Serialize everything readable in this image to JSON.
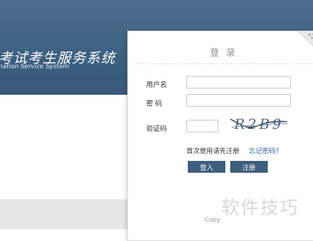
{
  "header": {
    "title": "考试考生服务系统",
    "subtitle": "nation Service System"
  },
  "login": {
    "title": "登 录",
    "username_label": "用户名",
    "username_value": "",
    "password_label": "密 码",
    "password_value": "",
    "captcha_label": "验证码",
    "captcha_value": "",
    "captcha_text": "R2B9",
    "first_use_text": "首次使用请先注册",
    "forgot_text": "忘记密码?",
    "login_button": "登入",
    "register_button": "注册",
    "copyright": "Copy"
  },
  "watermark": "软件技巧",
  "colors": {
    "header": "#3f6384",
    "button": "#3e5f7e",
    "link": "#2f5f9a",
    "footer": "#e6e6e6"
  },
  "icons": [
    "qr-code-icon"
  ]
}
